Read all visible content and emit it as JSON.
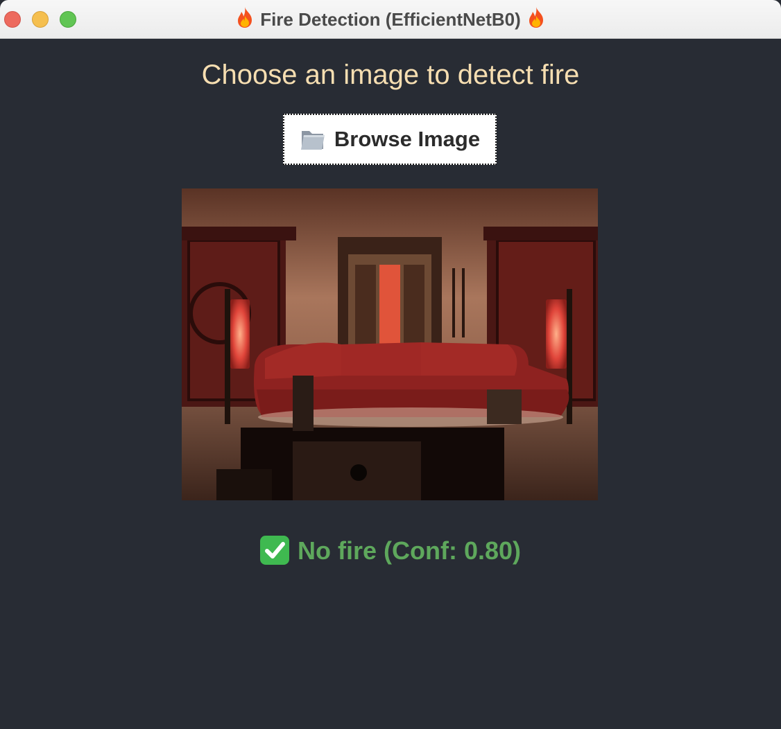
{
  "window": {
    "title": "Fire Detection (EfficientNetB0)",
    "title_icon": "fire-icon",
    "controls": [
      "close",
      "minimize",
      "maximize"
    ]
  },
  "heading": "Choose an image to detect fire",
  "browse_button": {
    "icon": "folder-icon",
    "label": "Browse Image"
  },
  "preview": {
    "description_icon": "image-preview"
  },
  "result": {
    "icon": "check-mark-icon",
    "text": "No fire (Conf: 0.80)",
    "color": "#5ea85c"
  },
  "colors": {
    "background": "#282c34",
    "heading": "#f6deb1"
  }
}
